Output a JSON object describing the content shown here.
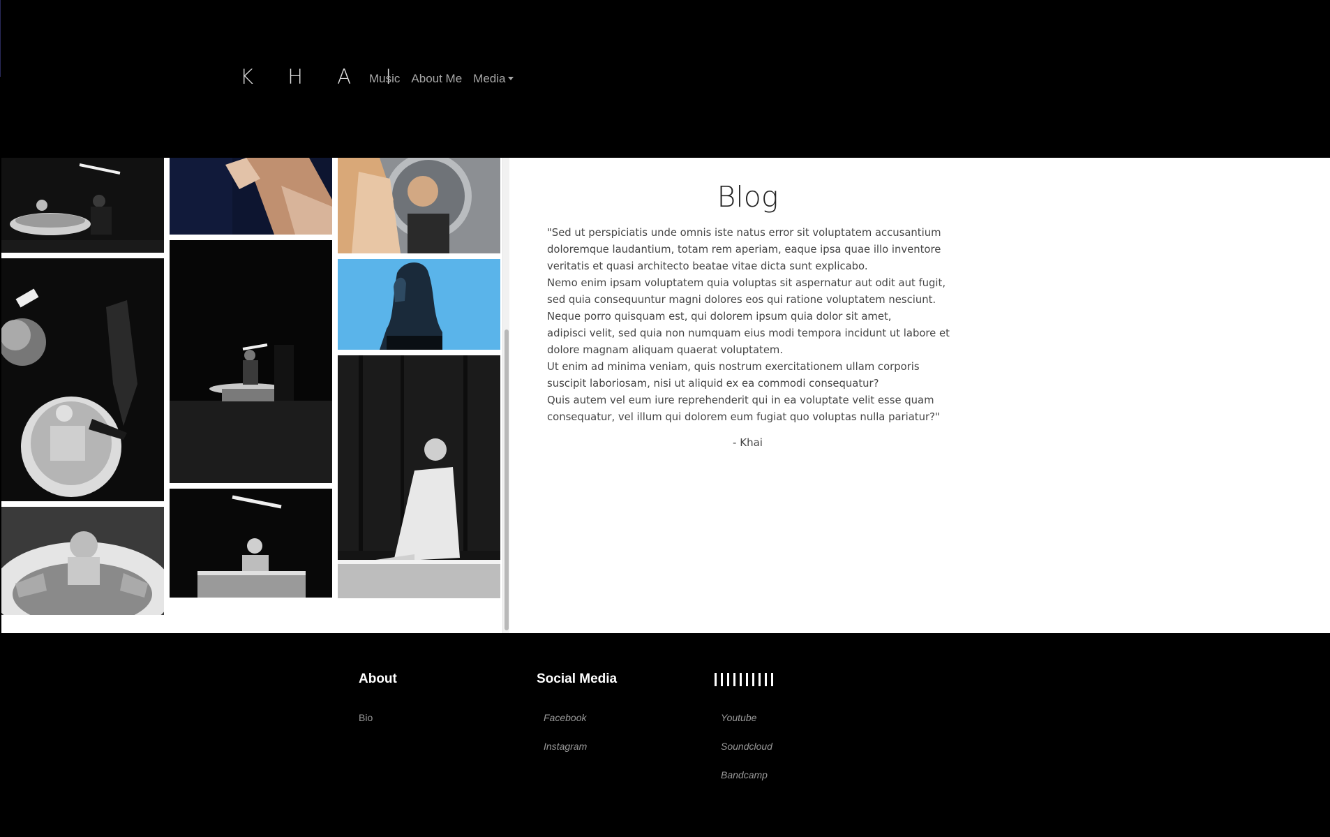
{
  "header": {
    "brand": "K H A I",
    "nav": {
      "music": "Music",
      "about": "About Me",
      "media": "Media"
    }
  },
  "gallery": {
    "photos": [
      {
        "name": "bath-lamp-wide",
        "desc": "black and white bathtub with light bar"
      },
      {
        "name": "hands-closeup",
        "desc": "hands reaching"
      },
      {
        "name": "mirror-portrait",
        "desc": "woman looking in round mirror"
      },
      {
        "name": "bath-overhead",
        "desc": "woman in bathtub from above"
      },
      {
        "name": "bath-dark-standing",
        "desc": "figure over bathtub in dark"
      },
      {
        "name": "blue-profile",
        "desc": "woman profile against blue"
      },
      {
        "name": "bath-closeup",
        "desc": "woman in bathtub close"
      },
      {
        "name": "bath-sitting",
        "desc": "woman sitting in bathtub under lamp"
      },
      {
        "name": "bath-looking-up",
        "desc": "woman in white shirt looking up"
      }
    ],
    "colors": {
      "dark": "#0b0b0b",
      "blue": "#5ab4ea"
    }
  },
  "blog": {
    "title": "Blog",
    "lines": [
      "\"Sed ut perspiciatis unde omnis iste natus error sit voluptatem accusantium",
      "doloremque laudantium, totam rem aperiam, eaque ipsa quae illo inventore",
      "veritatis et quasi architecto beatae vitae dicta sunt explicabo.",
      "Nemo enim ipsam voluptatem quia voluptas sit aspernatur aut odit aut fugit,",
      "sed quia consequuntur magni dolores eos qui ratione voluptatem nesciunt.",
      "Neque porro quisquam est, qui dolorem ipsum quia dolor sit amet,",
      "adipisci velit, sed quia non numquam eius modi tempora incidunt ut labore et",
      "dolore magnam aliquam quaerat voluptatem.",
      "Ut enim ad minima veniam, quis nostrum exercitationem ullam corporis",
      "suscipit laboriosam, nisi ut aliquid ex ea commodi consequatur?",
      "Quis autem vel eum iure reprehenderit qui in ea voluptate velit esse quam",
      "consequatur, vel illum qui dolorem eum fugiat quo voluptas nulla pariatur?\""
    ],
    "signature": "- Khai"
  },
  "footer": {
    "about": {
      "heading": "About",
      "links": [
        "Bio"
      ]
    },
    "social": {
      "heading": "Social Media",
      "links": [
        "Facebook",
        "Instagram"
      ]
    },
    "music": {
      "heading_icon": "bars-icon",
      "links": [
        "Youtube",
        "Soundcloud",
        "Bandcamp"
      ]
    }
  }
}
